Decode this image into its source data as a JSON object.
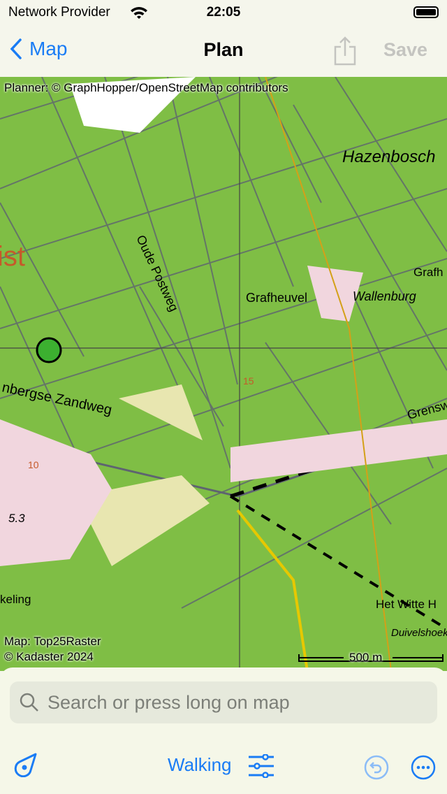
{
  "status": {
    "carrier": "Network Provider",
    "time": "22:05"
  },
  "nav": {
    "back_label": "Map",
    "title": "Plan",
    "save_label": "Save"
  },
  "map": {
    "attribution_top": "Planner: © GraphHopper/OpenStreetMap contributors",
    "attribution_bottom_1": "Map: Top25Raster",
    "attribution_bottom_2": "© Kadaster 2024",
    "scale_label": "500 m",
    "labels": {
      "hazenbosch": "Hazenbosch",
      "ist": "ist",
      "oude_postweg": "Oude Postweg",
      "grafheuvel": "Grafheuvel",
      "wallenburg": "Wallenburg",
      "graft": "Grafh",
      "zandweg": "nbergse Zandweg",
      "grensw": "Grensw",
      "elev": "5.3",
      "keling": "keling",
      "witte": "Het Witte H",
      "duivelshoek": "Duivelshoek",
      "c15": "15",
      "c10": "10"
    }
  },
  "search": {
    "placeholder": "Search or press long on map"
  },
  "toolbar": {
    "profile_label": "Walking"
  },
  "colors": {
    "accent": "#1a7cf5",
    "forest": "#7fbe45",
    "marker": "#3cb030"
  }
}
